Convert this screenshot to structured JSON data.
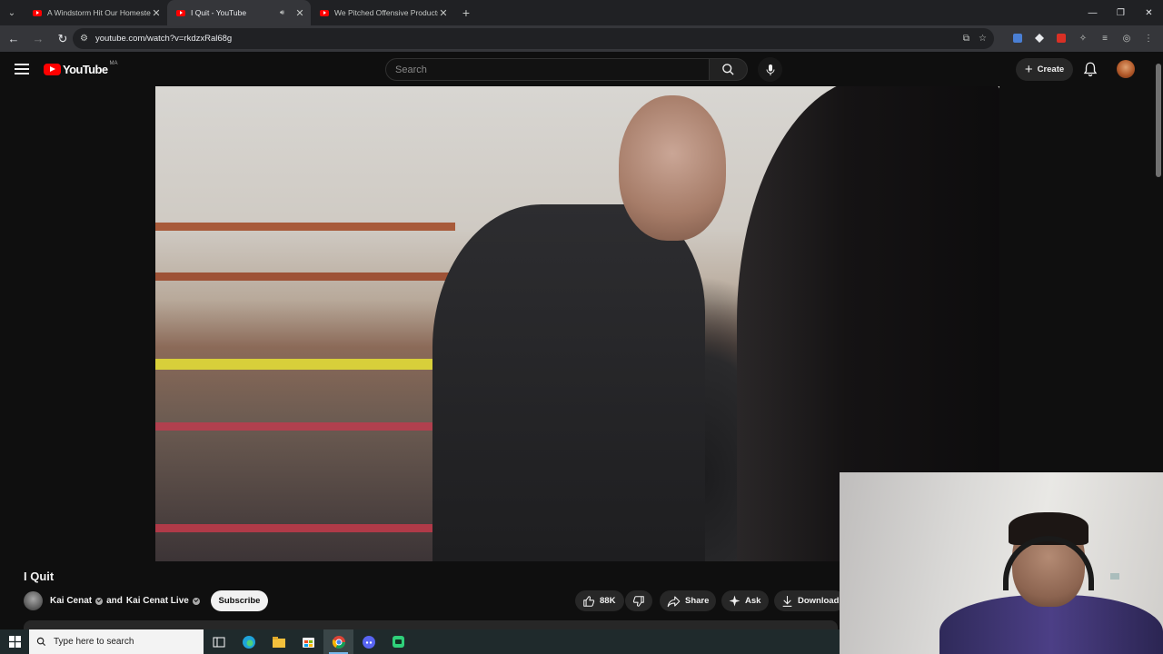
{
  "browser": {
    "tabs": [
      {
        "title": "A Windstorm Hit Our Homeste",
        "active": false
      },
      {
        "title": "I Quit - YouTube",
        "active": true
      },
      {
        "title": "We Pitched Offensive Products",
        "active": false
      }
    ],
    "url": "youtube.com/watch?v=rkdzxRal68g"
  },
  "masthead": {
    "logo_text": "YouTube",
    "country_code": "MA",
    "search_placeholder": "Search",
    "create_label": "Create"
  },
  "video": {
    "title": "I Quit",
    "channel_primary": "Kai Cenat",
    "channel_joiner": "and",
    "channel_secondary": "Kai Cenat Live",
    "subscribe_label": "Subscribe",
    "likes": "88K",
    "share_label": "Share",
    "ask_label": "Ask",
    "download_label": "Download"
  },
  "taskbar": {
    "search_placeholder": "Type here to search"
  },
  "colors": {
    "yt_red": "#ff0000",
    "background": "#0f0f0f",
    "pill": "#272727",
    "taskbar": "#1f2a2c"
  }
}
